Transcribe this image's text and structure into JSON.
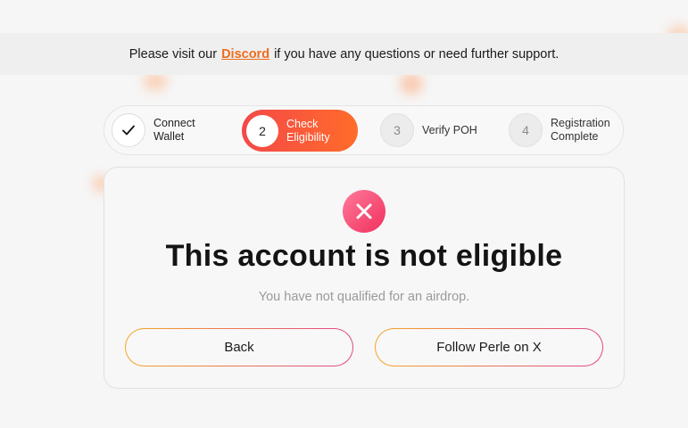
{
  "banner": {
    "prefix": "Please visit our",
    "link": "Discord",
    "suffix": "if you have any questions or need further support."
  },
  "steps": [
    {
      "number": "",
      "icon": "check-icon",
      "line1": "Connect",
      "line2": "Wallet",
      "status": "done"
    },
    {
      "number": "2",
      "line1": "Check",
      "line2": "Eligibility",
      "status": "active"
    },
    {
      "number": "3",
      "line1": "Verify POH",
      "line2": "",
      "status": "pending"
    },
    {
      "number": "4",
      "line1": "Registration",
      "line2": "Complete",
      "status": "pending"
    }
  ],
  "result": {
    "icon": "close-circle-icon",
    "title": "This account is not eligible",
    "subtitle": "You have not qualified for an airdrop."
  },
  "buttons": {
    "back": "Back",
    "follow": "Follow Perle on X"
  },
  "colors": {
    "accent": "#ef6c1a",
    "active_step_start": "#f44848",
    "active_step_end": "#ff6c2a",
    "error": "#f0305d"
  }
}
